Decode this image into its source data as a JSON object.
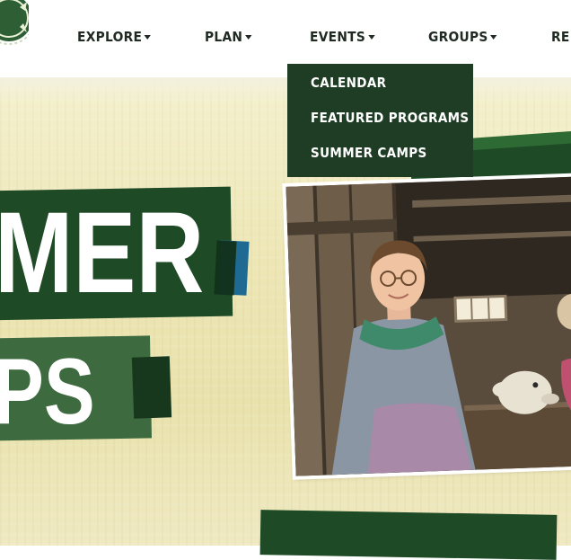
{
  "nav": {
    "items": [
      {
        "label": "EXPLORE"
      },
      {
        "label": "PLAN"
      },
      {
        "label": "EVENTS"
      },
      {
        "label": "GROUPS"
      },
      {
        "label": "RE"
      }
    ]
  },
  "events_menu": {
    "items": [
      "CALENDAR",
      "FEATURED PROGRAMS",
      "SUMMER CAMPS"
    ]
  },
  "hero": {
    "line1": "MER",
    "line2": "PS"
  },
  "colors": {
    "dark_green": "#1e3d24",
    "banner_green": "#1e4a26",
    "mid_green": "#3d6b3f",
    "accent_blue": "#1e6a93",
    "parchment": "#ede6b5"
  }
}
